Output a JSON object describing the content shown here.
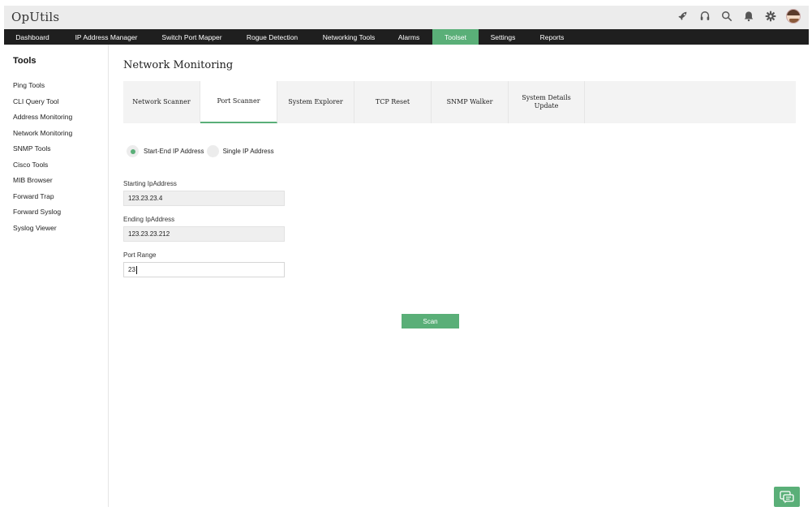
{
  "app": {
    "title": "OpUtils"
  },
  "header_icons": [
    "rocket-icon",
    "headset-icon",
    "search-icon",
    "bell-icon",
    "gear-icon",
    "user-avatar"
  ],
  "nav": {
    "items": [
      {
        "label": "Dashboard"
      },
      {
        "label": "IP Address Manager"
      },
      {
        "label": "Switch Port Mapper"
      },
      {
        "label": "Rogue Detection"
      },
      {
        "label": "Networking Tools"
      },
      {
        "label": "Alarms"
      },
      {
        "label": "Toolset"
      },
      {
        "label": "Settings"
      },
      {
        "label": "Reports"
      }
    ],
    "active": "Toolset"
  },
  "sidebar": {
    "heading": "Tools",
    "items": [
      {
        "label": "Ping Tools"
      },
      {
        "label": "CLI Query Tool"
      },
      {
        "label": "Address Monitoring"
      },
      {
        "label": "Network Monitoring"
      },
      {
        "label": "SNMP Tools"
      },
      {
        "label": "Cisco Tools"
      },
      {
        "label": "MIB Browser"
      },
      {
        "label": "Forward Trap"
      },
      {
        "label": "Forward Syslog"
      },
      {
        "label": "Syslog Viewer"
      }
    ]
  },
  "main": {
    "title": "Network Monitoring",
    "tabs": [
      {
        "label": "Network Scanner"
      },
      {
        "label": "Port Scanner"
      },
      {
        "label": "System Explorer"
      },
      {
        "label": "TCP Reset"
      },
      {
        "label": "SNMP Walker"
      },
      {
        "label": "System Details Update"
      }
    ],
    "active_tab": "Port Scanner",
    "radio": {
      "option1": "Start-End IP Address",
      "option2": "Single IP Address",
      "selected": "Start-End IP Address"
    },
    "fields": {
      "start_label": "Starting IpAddress",
      "start_value": "123.23.23.4",
      "end_label": "Ending IpAddress",
      "end_value": "123.23.23.212",
      "port_label": "Port Range",
      "port_value": "23"
    },
    "scan_label": "Scan"
  },
  "colors": {
    "accent": "#5aaf78",
    "nav_bg": "#1f1f1f",
    "header_bg": "#ececec",
    "tab_bg": "#f3f3f3"
  }
}
